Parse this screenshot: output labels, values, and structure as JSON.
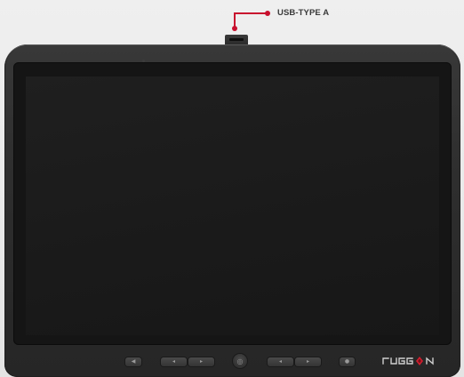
{
  "callout": {
    "label": "USB-TYPE A",
    "color": "#c8102e"
  },
  "device": {
    "brand_logo": "RUGGON",
    "body_color": "#2e2e2e",
    "screen_color": "#1a1a1a"
  },
  "hardware_buttons": [
    {
      "name": "power",
      "icon": "power-icon"
    },
    {
      "name": "left-rocker",
      "icon": "rocker-icon"
    },
    {
      "name": "home",
      "icon": "home-icon"
    },
    {
      "name": "right-rocker",
      "icon": "rocker-icon"
    },
    {
      "name": "settings",
      "icon": "settings-icon"
    }
  ]
}
